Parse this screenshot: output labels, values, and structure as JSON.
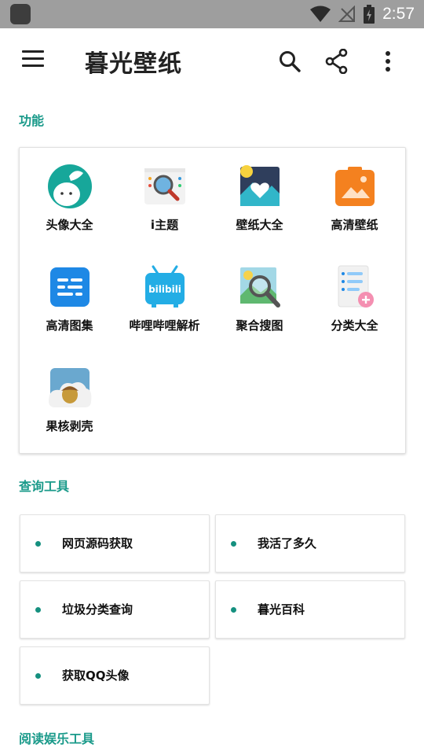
{
  "status_bar": {
    "time": "2:57"
  },
  "app_bar": {
    "title": "暮光壁纸"
  },
  "sections": {
    "features_title": "功能",
    "query_title": "查询工具",
    "reading_title": "阅读娱乐工具"
  },
  "features": [
    {
      "label": "头像大全",
      "icon": "avatar-icon"
    },
    {
      "label": "i主题",
      "icon": "itheme-icon"
    },
    {
      "label": "壁纸大全",
      "icon": "wallpaper-icon"
    },
    {
      "label": "高清壁纸",
      "icon": "hd-wallpaper-icon"
    },
    {
      "label": "高清图集",
      "icon": "hd-album-icon"
    },
    {
      "label": "哔哩哔哩解析",
      "icon": "bilibili-icon"
    },
    {
      "label": "聚合搜图",
      "icon": "image-search-icon"
    },
    {
      "label": "分类大全",
      "icon": "category-icon"
    },
    {
      "label": "果核剥壳",
      "icon": "acorn-icon"
    }
  ],
  "query_tools": [
    {
      "label": "网页源码获取"
    },
    {
      "label": "我活了多久"
    },
    {
      "label": "垃圾分类查询"
    },
    {
      "label": "暮光百科"
    },
    {
      "label": "获取QQ头像"
    }
  ],
  "colors": {
    "accent": "#1a9a8a",
    "status_bar": "#9e9e9e"
  }
}
